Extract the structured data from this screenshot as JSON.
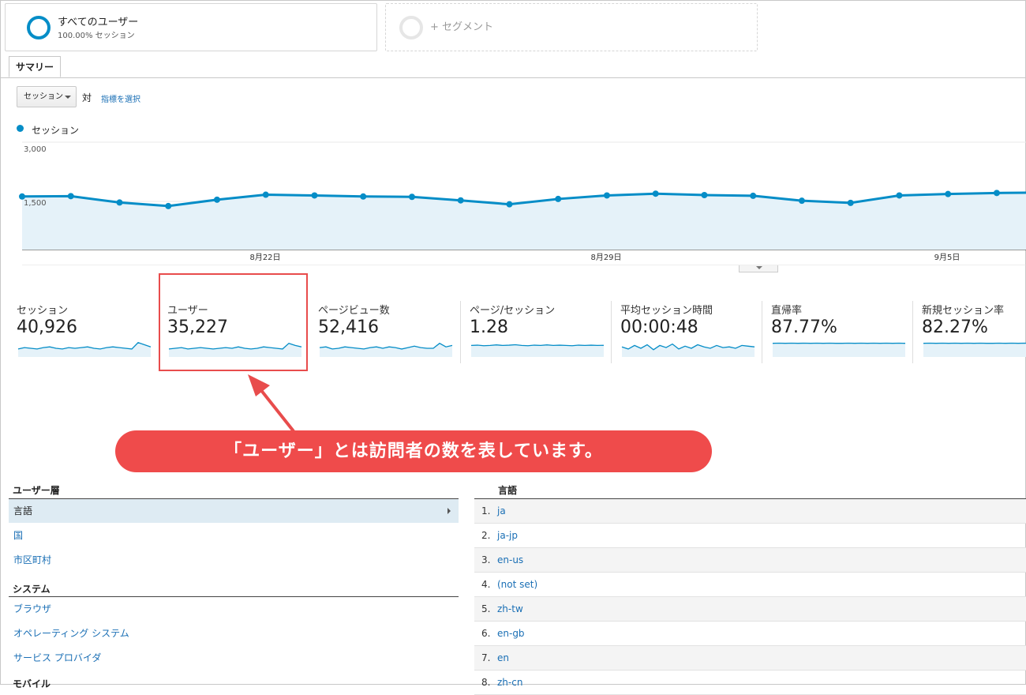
{
  "segments": {
    "active": {
      "title": "すべてのユーザー",
      "subtitle": "100.00% セッション"
    },
    "add_label": "+ セグメント"
  },
  "tab": {
    "label": "サマリー"
  },
  "metric_selector": {
    "selected": "セッション",
    "vs_label": "対",
    "pick_label": "指標を選択"
  },
  "chart_data": {
    "type": "line",
    "series": [
      {
        "name": "セッション",
        "values": [
          1500,
          1510,
          1330,
          1230,
          1410,
          1550,
          1530,
          1500,
          1490,
          1390,
          1280,
          1430,
          1530,
          1580,
          1540,
          1520,
          1380,
          1320,
          1530,
          1570,
          1600,
          1610
        ]
      }
    ],
    "x_ticks": [
      "8月22日",
      "8月29日",
      "9月5日"
    ],
    "y_ticks": [
      "3,000",
      "1,500"
    ],
    "ylim": [
      0,
      3000
    ],
    "color": "#058dc7",
    "fill": "#e5f2f9"
  },
  "scorecards": [
    {
      "label": "セッション",
      "value": "40,926",
      "spark": [
        0.45,
        0.55,
        0.5,
        0.45,
        0.55,
        0.6,
        0.5,
        0.45,
        0.55,
        0.5,
        0.55,
        0.6,
        0.5,
        0.45,
        0.55,
        0.6,
        0.55,
        0.5,
        0.45,
        0.9,
        0.75,
        0.6
      ]
    },
    {
      "label": "ユーザー",
      "value": "35,227",
      "spark": [
        0.45,
        0.5,
        0.55,
        0.45,
        0.5,
        0.55,
        0.5,
        0.45,
        0.5,
        0.55,
        0.5,
        0.6,
        0.5,
        0.45,
        0.5,
        0.6,
        0.55,
        0.5,
        0.45,
        0.85,
        0.7,
        0.6
      ]
    },
    {
      "label": "ページビュー数",
      "value": "52,416",
      "spark": [
        0.55,
        0.6,
        0.45,
        0.5,
        0.6,
        0.55,
        0.5,
        0.45,
        0.55,
        0.6,
        0.5,
        0.6,
        0.55,
        0.45,
        0.55,
        0.65,
        0.55,
        0.5,
        0.5,
        0.85,
        0.6,
        0.7
      ]
    },
    {
      "label": "ページ/セッション",
      "value": "1.28",
      "spark": [
        0.7,
        0.72,
        0.68,
        0.7,
        0.74,
        0.7,
        0.72,
        0.75,
        0.7,
        0.68,
        0.72,
        0.7,
        0.74,
        0.7,
        0.72,
        0.7,
        0.68,
        0.72,
        0.7,
        0.72,
        0.7,
        0.71
      ]
    },
    {
      "label": "平均セッション時間",
      "value": "00:00:48",
      "spark": [
        0.6,
        0.45,
        0.7,
        0.5,
        0.75,
        0.4,
        0.7,
        0.55,
        0.8,
        0.45,
        0.65,
        0.5,
        0.75,
        0.6,
        0.5,
        0.7,
        0.55,
        0.6,
        0.5,
        0.7,
        0.65,
        0.6
      ]
    },
    {
      "label": "直帰率",
      "value": "87.77%",
      "spark": [
        0.85,
        0.86,
        0.85,
        0.86,
        0.85,
        0.86,
        0.85,
        0.86,
        0.85,
        0.86,
        0.85,
        0.85,
        0.86,
        0.85,
        0.86,
        0.85,
        0.86,
        0.85,
        0.86,
        0.85,
        0.86,
        0.85
      ]
    },
    {
      "label": "新規セッション率",
      "value": "82.27%",
      "spark": [
        0.85,
        0.86,
        0.85,
        0.86,
        0.85,
        0.86,
        0.85,
        0.86,
        0.85,
        0.86,
        0.85,
        0.85,
        0.86,
        0.85,
        0.86,
        0.85,
        0.86,
        0.85,
        0.86,
        0.85,
        0.86,
        0.85
      ]
    }
  ],
  "callout": {
    "text": "「ユーザー」とは訪問者の数を表しています。"
  },
  "nav": {
    "group1_title": "ユーザー層",
    "group1_items": [
      "言語",
      "国",
      "市区町村"
    ],
    "group2_title": "システム",
    "group2_items": [
      "ブラウザ",
      "オペレーティング システム",
      "サービス プロバイダ"
    ],
    "group3_title": "モバイル"
  },
  "table": {
    "header": "言語",
    "rows": [
      {
        "index": "1.",
        "value": "ja"
      },
      {
        "index": "2.",
        "value": "ja-jp"
      },
      {
        "index": "3.",
        "value": "en-us"
      },
      {
        "index": "4.",
        "value": "(not set)"
      },
      {
        "index": "5.",
        "value": "zh-tw"
      },
      {
        "index": "6.",
        "value": "en-gb"
      },
      {
        "index": "7.",
        "value": "en"
      },
      {
        "index": "8.",
        "value": "zh-cn"
      }
    ]
  }
}
